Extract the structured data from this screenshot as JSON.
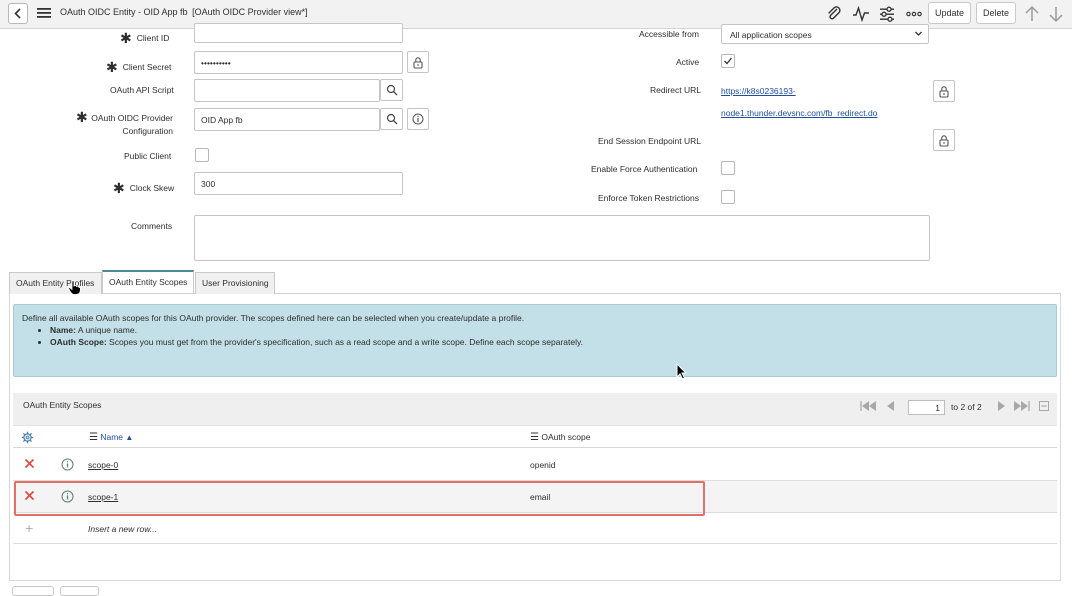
{
  "header": {
    "title": "OAuth OIDC Entity - OID App fb",
    "view": "[OAuth OIDC Provider view*]",
    "update_label": "Update",
    "delete_label": "Delete",
    "icons": [
      "back-icon",
      "menu-icon",
      "attachment-icon",
      "activity-icon",
      "settings-sliders-icon",
      "more-icon",
      "up-arrow-icon",
      "down-arrow-icon"
    ]
  },
  "form": {
    "client_id_label": "Client ID",
    "client_secret_label": "Client Secret",
    "client_secret_value": "••••••••••",
    "api_script_label": "OAuth API Script",
    "provider_config_label": "OAuth OIDC Provider Configuration",
    "provider_config_value": "OID App fb",
    "public_client_label": "Public Client",
    "clock_skew_label": "Clock Skew",
    "clock_skew_value": "300",
    "comments_label": "Comments",
    "accessible_from_label": "Accessible from",
    "accessible_from_value": "All application scopes",
    "active_label": "Active",
    "active_checked": true,
    "redirect_url_label": "Redirect URL",
    "redirect_url_line1": "https://k8s0236193-",
    "redirect_url_line2": "node1.thunder.devsnc.com/fb_redirect.do",
    "end_session_label": "End Session Endpoint URL",
    "force_auth_label": "Enable Force Authentication",
    "token_restrictions_label": "Enforce Token Restrictions"
  },
  "tabs": [
    {
      "label": "OAuth Entity Profiles",
      "active": false
    },
    {
      "label": "OAuth Entity Scopes",
      "active": true
    },
    {
      "label": "User Provisioning",
      "active": false
    }
  ],
  "info": {
    "intro": "Define all available OAuth scopes for this OAuth provider. The scopes defined here can be selected when you create/update a profile.",
    "bullet1_key": "Name:",
    "bullet1_text": " A unique name.",
    "bullet2_key": "OAuth Scope:",
    "bullet2_text": " Scopes you must get from the provider's specification, such as a read scope and a write scope. Define each scope separately."
  },
  "list": {
    "title": "OAuth Entity Scopes",
    "page_value": "1",
    "page_total": "to 2 of 2",
    "columns": {
      "name": "Name",
      "scope": "OAuth scope"
    },
    "rows": [
      {
        "name": "scope-0",
        "scope": "openid"
      },
      {
        "name": "scope-1",
        "scope": "email"
      }
    ],
    "insert_text": "Insert a new row..."
  },
  "colors": {
    "topbar": "#f2f2f2",
    "info_bg": "#c3dfe7",
    "link": "#1f4e9e",
    "delete_x": "#e0483e",
    "highlight": "#e2706a",
    "tab_accent": "#4f8c91"
  }
}
